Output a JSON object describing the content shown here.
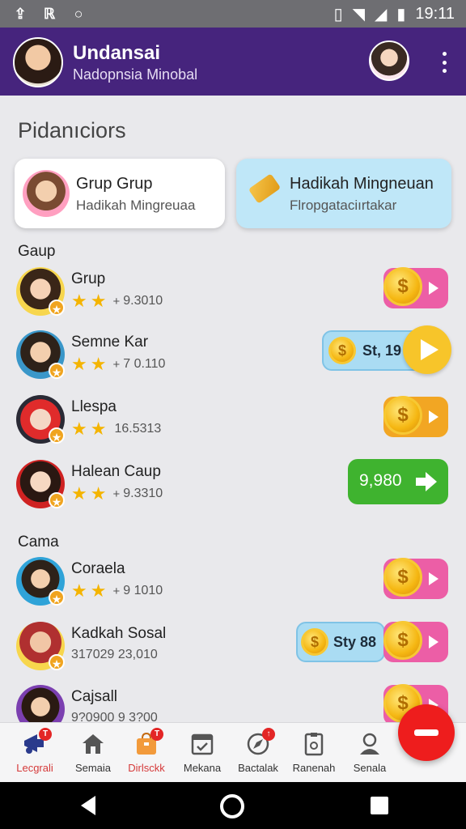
{
  "status_bar": {
    "time": "19:11"
  },
  "header": {
    "title": "Undansai",
    "subtitle": "Nadopnsia Minobal"
  },
  "page_title": "Pidanıciors",
  "cards": [
    {
      "title": "Grup Grup",
      "subtitle": "Hadikah Mingreuaa"
    },
    {
      "title": "Hadikah Mingneuan",
      "subtitle": "Flropgataciırtakar"
    }
  ],
  "sections": [
    {
      "label": "Gaup"
    },
    {
      "label": "Cama"
    }
  ],
  "rows": [
    {
      "name": "Grup",
      "meta": "9.3010",
      "action": "pink"
    },
    {
      "name": "Semne Kar",
      "meta": "7 0.110",
      "action": "blue-play",
      "pill_text": "St, 19"
    },
    {
      "name": "Llespa",
      "meta": "16.5313",
      "action": "orange"
    },
    {
      "name": "Halean Caup",
      "meta": "9.3310",
      "action": "green",
      "pill_text": "9,980"
    },
    {
      "name": "Coraela",
      "meta": "9 1010",
      "action": "pink"
    },
    {
      "name": "Kadkah Sosal",
      "meta": "317029 23,010",
      "action": "blue-pink",
      "pill_text": "Sty 88"
    },
    {
      "name": "Cajsall",
      "meta": "9?0900 9 3?00",
      "action": "pink"
    }
  ],
  "nav": [
    {
      "label": "Lecgrali",
      "icon": "megaphone-icon",
      "badge": "T"
    },
    {
      "label": "Semaia",
      "icon": "home-icon"
    },
    {
      "label": "Dirlsckk",
      "icon": "bag-icon",
      "badge": "T"
    },
    {
      "label": "Mekana",
      "icon": "calendar-icon"
    },
    {
      "label": "Bactalak",
      "icon": "compass-icon",
      "badge": "↑"
    },
    {
      "label": "Ranenah",
      "icon": "clipboard-icon"
    },
    {
      "label": "Senala",
      "icon": "person-icon"
    }
  ],
  "colors": {
    "header": "#46247d",
    "accent_red": "#ee1d1d",
    "pink": "#ec5ea6",
    "orange": "#f2a623",
    "green": "#3fb32f",
    "blue": "#aadcf3"
  }
}
